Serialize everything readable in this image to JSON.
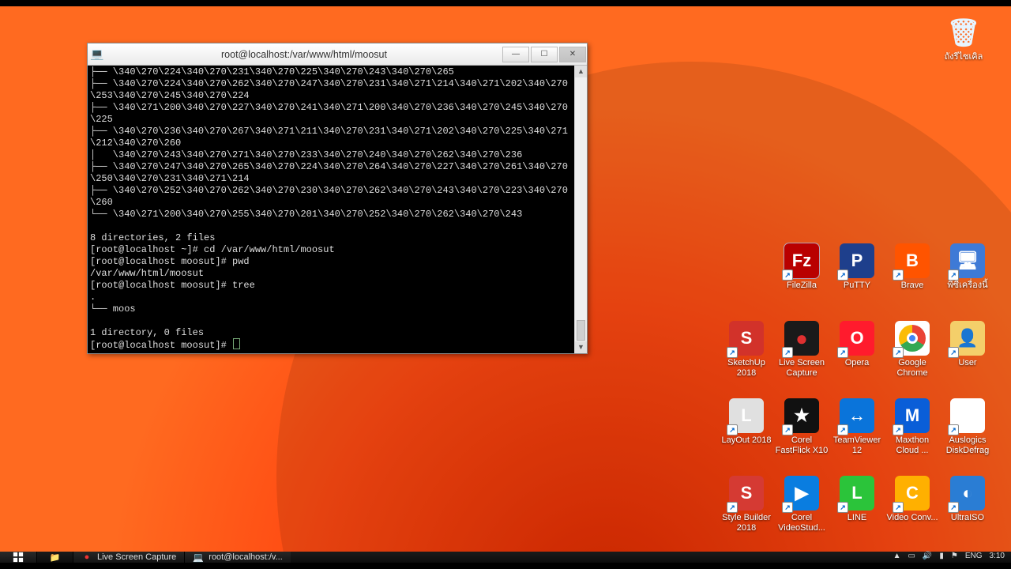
{
  "recycle_bin": {
    "label": "ถังรีไซเคิล"
  },
  "desktop_icons": {
    "row1": [
      {
        "name": "filezilla",
        "label": "FileZilla",
        "bg": "#b90000",
        "letter": "Fz",
        "selected": true
      },
      {
        "name": "putty",
        "label": "PuTTY",
        "bg": "#1e3f8c",
        "letter": "P"
      },
      {
        "name": "brave",
        "label": "Brave",
        "bg": "#ff5400",
        "letter": "B"
      },
      {
        "name": "this-pc",
        "label": "พีซีเครื่องนี้",
        "bg": "#3e7ad6",
        "letter": "🖥"
      }
    ],
    "row2": [
      {
        "name": "sketchup",
        "label": "SketchUp 2018",
        "bg": "#d2322a",
        "letter": "S"
      },
      {
        "name": "live-screen-capture",
        "label": "Live Screen Capture",
        "bg": "#1a1a1a",
        "letter": "●",
        "dot": "#e03030"
      },
      {
        "name": "opera",
        "label": "Opera",
        "bg": "#ff1b2d",
        "letter": "O"
      },
      {
        "name": "chrome",
        "label": "Google Chrome",
        "bg": "#ffffff",
        "letter": "◉"
      },
      {
        "name": "user",
        "label": "User",
        "bg": "#f4cf6a",
        "letter": "👤"
      }
    ],
    "row3": [
      {
        "name": "layout",
        "label": "LayOut 2018",
        "bg": "#e0e0e0",
        "letter": "L"
      },
      {
        "name": "fastflick",
        "label": "Corel FastFlick X10",
        "bg": "#111111",
        "letter": "★"
      },
      {
        "name": "teamviewer",
        "label": "TeamViewer 12",
        "bg": "#0a74da",
        "letter": "↔"
      },
      {
        "name": "maxthon",
        "label": "Maxthon Cloud ...",
        "bg": "#0a5ed8",
        "letter": "M"
      },
      {
        "name": "auslogics",
        "label": "Auslogics DiskDefrag",
        "bg": "#ffffff",
        "letter": "▦"
      }
    ],
    "row4": [
      {
        "name": "stylebuilder",
        "label": "Style Builder 2018",
        "bg": "#d53a33",
        "letter": "S"
      },
      {
        "name": "videostudio",
        "label": "Corel VideoStud...",
        "bg": "#0a7de0",
        "letter": "▶"
      },
      {
        "name": "line",
        "label": "LINE",
        "bg": "#2bc43a",
        "letter": "L"
      },
      {
        "name": "videoconv",
        "label": "Video Conv...",
        "bg": "#ffb000",
        "letter": "C"
      },
      {
        "name": "ultraiso",
        "label": "UltraISO",
        "bg": "#2a7dd4",
        "letter": "◐"
      }
    ]
  },
  "terminal": {
    "title": "root@localhost:/var/www/html/moosut",
    "min": "—",
    "max": "☐",
    "close": "✕",
    "body": "├── \\340\\270\\224\\340\\270\\231\\340\\270\\225\\340\\270\\243\\340\\270\\265\n├── \\340\\270\\224\\340\\270\\262\\340\\270\\247\\340\\270\\231\\340\\271\\214\\340\\271\\202\\340\\270\\253\\340\\270\\245\\340\\270\\224\n├── \\340\\271\\200\\340\\270\\227\\340\\270\\241\\340\\271\\200\\340\\270\\236\\340\\270\\245\\340\\270\\225\n├── \\340\\270\\236\\340\\270\\267\\340\\271\\211\\340\\270\\231\\340\\271\\202\\340\\270\\225\\340\\271\\212\\340\\270\\260\n│   \\340\\270\\243\\340\\270\\271\\340\\270\\233\\340\\270\\240\\340\\270\\262\\340\\270\\236\n├── \\340\\270\\247\\340\\270\\265\\340\\270\\224\\340\\270\\264\\340\\270\\227\\340\\270\\261\\340\\270\\250\\340\\270\\231\\340\\271\\214\n├── \\340\\270\\252\\340\\270\\262\\340\\270\\230\\340\\270\\262\\340\\270\\243\\340\\270\\223\\340\\270\\260\n└── \\340\\271\\200\\340\\270\\255\\340\\270\\201\\340\\270\\252\\340\\270\\262\\340\\270\\243\n\n8 directories, 2 files\n[root@localhost ~]# cd /var/www/html/moosut\n[root@localhost moosut]# pwd\n/var/www/html/moosut\n[root@localhost moosut]# tree\n.\n└── moos\n\n1 directory, 0 files\n[root@localhost moosut]# "
  },
  "taskbar": {
    "items": [
      {
        "name": "lsc",
        "label": "Live Screen Capture"
      },
      {
        "name": "putty",
        "label": "root@localhost:/v..."
      }
    ],
    "lang": "ENG",
    "time": "3:10"
  }
}
